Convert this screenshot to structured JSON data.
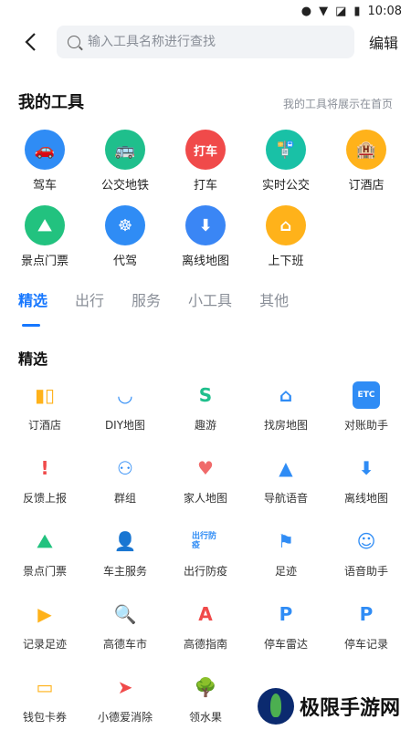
{
  "status": {
    "time": "10:08"
  },
  "search": {
    "placeholder": "输入工具名称进行查找"
  },
  "header": {
    "edit_label": "编辑"
  },
  "my_tools": {
    "title": "我的工具",
    "hint": "我的工具将展示在首页",
    "items": [
      {
        "label": "驾车",
        "icon": "car-icon",
        "color": "#2f8cf5",
        "glyph": "🚗"
      },
      {
        "label": "公交地铁",
        "icon": "bus-icon",
        "color": "#1fbf8c",
        "glyph": "🚌"
      },
      {
        "label": "打车",
        "icon": "taxi-icon",
        "color": "#f04a4a",
        "glyph": "打车"
      },
      {
        "label": "实时公交",
        "icon": "realtime-bus-icon",
        "color": "#19c1a6",
        "glyph": "🚏"
      },
      {
        "label": "订酒店",
        "icon": "hotel-icon",
        "color": "#ffb21a",
        "glyph": "🏨"
      },
      {
        "label": "景点门票",
        "icon": "scenic-ticket-icon",
        "color": "#22c27f",
        "glyph": "⛰"
      },
      {
        "label": "代驾",
        "icon": "steering-wheel-icon",
        "color": "#2f8cf5",
        "glyph": "☸"
      },
      {
        "label": "离线地图",
        "icon": "offline-map-icon",
        "color": "#3a86f5",
        "glyph": "⬇"
      },
      {
        "label": "上下班",
        "icon": "commute-icon",
        "color": "#ffb21a",
        "glyph": "⌂"
      }
    ]
  },
  "tabs": [
    "精选",
    "出行",
    "服务",
    "小工具",
    "其他"
  ],
  "featured": {
    "title": "精选",
    "items": [
      {
        "label": "订酒店",
        "icon": "hotel-icon",
        "color": "#ffb21a",
        "glyph": "▮▯"
      },
      {
        "label": "DIY地图",
        "icon": "diy-map-icon",
        "color": "#2f8cf5",
        "glyph": "◡"
      },
      {
        "label": "趣游",
        "icon": "fun-trip-icon",
        "color": "#1fbf8c",
        "glyph": "S"
      },
      {
        "label": "找房地图",
        "icon": "house-search-icon",
        "color": "#2f8cf5",
        "glyph": "⌂"
      },
      {
        "label": "对账助手",
        "icon": "etc-icon",
        "color": "#2f8cf5",
        "glyph": "ETC"
      },
      {
        "label": "反馈上报",
        "icon": "feedback-icon",
        "color": "#f04a4a",
        "glyph": "!"
      },
      {
        "label": "群组",
        "icon": "group-icon",
        "color": "#2f8cf5",
        "glyph": "⚇"
      },
      {
        "label": "家人地图",
        "icon": "family-map-icon",
        "color": "#f06a6a",
        "glyph": "♥"
      },
      {
        "label": "导航语音",
        "icon": "nav-voice-icon",
        "color": "#2f8cf5",
        "glyph": "▲"
      },
      {
        "label": "离线地图",
        "icon": "offline-map-icon",
        "color": "#2f8cf5",
        "glyph": "⬇"
      },
      {
        "label": "景点门票",
        "icon": "scenic-ticket-icon",
        "color": "#22c27f",
        "glyph": "⛰"
      },
      {
        "label": "车主服务",
        "icon": "car-owner-icon",
        "color": "#f06a6a",
        "glyph": "👤"
      },
      {
        "label": "出行防疫",
        "icon": "epidemic-icon",
        "color": "#2f8cf5",
        "glyph": "出行防疫"
      },
      {
        "label": "足迹",
        "icon": "footprint-icon",
        "color": "#2f8cf5",
        "glyph": "⚑"
      },
      {
        "label": "语音助手",
        "icon": "voice-assistant-icon",
        "color": "#2f8cf5",
        "glyph": "☺"
      },
      {
        "label": "记录足迹",
        "icon": "record-footprint-icon",
        "color": "#ffb21a",
        "glyph": "▶"
      },
      {
        "label": "高德车市",
        "icon": "car-market-icon",
        "color": "#2f8cf5",
        "glyph": "🔍"
      },
      {
        "label": "高德指南",
        "icon": "guide-icon",
        "color": "#f04a4a",
        "glyph": "A"
      },
      {
        "label": "停车雷达",
        "icon": "parking-radar-icon",
        "color": "#2f8cf5",
        "glyph": "P"
      },
      {
        "label": "停车记录",
        "icon": "parking-record-icon",
        "color": "#2f8cf5",
        "glyph": "P"
      },
      {
        "label": "钱包卡券",
        "icon": "wallet-icon",
        "color": "#ffb21a",
        "glyph": "▭"
      },
      {
        "label": "小德爱消除",
        "icon": "game-icon",
        "color": "#f04a4a",
        "glyph": "➤"
      },
      {
        "label": "领水果",
        "icon": "fruit-tree-icon",
        "color": "#1fbf8c",
        "glyph": "🌳"
      }
    ]
  },
  "watermark": {
    "text": "极限手游网"
  }
}
